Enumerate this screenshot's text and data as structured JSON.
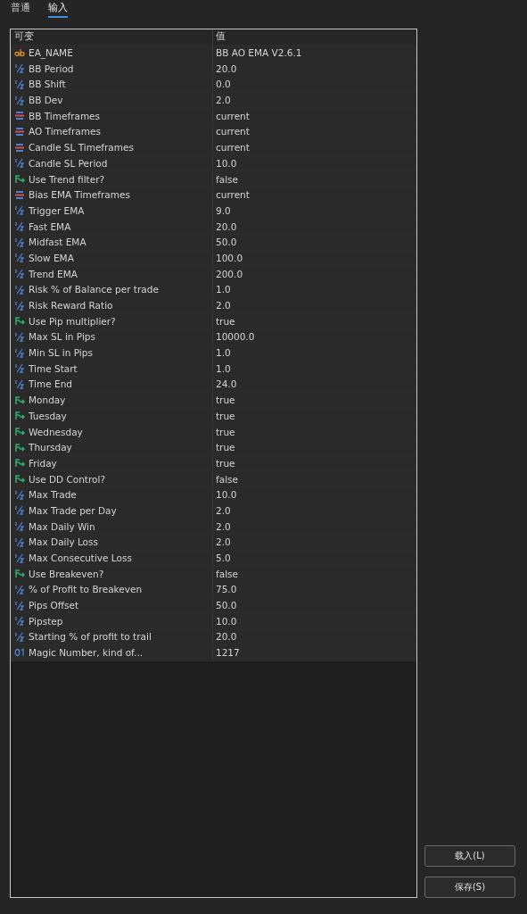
{
  "tabs": [
    {
      "label": "普通",
      "selected": false
    },
    {
      "label": "输入",
      "selected": true
    }
  ],
  "table": {
    "columns": [
      "可变",
      "值"
    ],
    "rows": [
      {
        "kind": "string",
        "name": "EA_NAME",
        "value": "BB AO EMA V2.6.1"
      },
      {
        "kind": "double",
        "name": "BB Period",
        "value": "20.0"
      },
      {
        "kind": "double",
        "name": "BB Shift",
        "value": "0.0"
      },
      {
        "kind": "double",
        "name": "BB Dev",
        "value": "2.0"
      },
      {
        "kind": "enum",
        "name": "BB Timeframes",
        "value": "current"
      },
      {
        "kind": "enum",
        "name": "AO Timeframes",
        "value": "current"
      },
      {
        "kind": "enum",
        "name": "Candle SL Timeframes",
        "value": "current"
      },
      {
        "kind": "double",
        "name": "Candle SL Period",
        "value": "10.0"
      },
      {
        "kind": "bool",
        "name": "Use Trend filter?",
        "value": "false"
      },
      {
        "kind": "enum",
        "name": "Bias EMA Timeframes",
        "value": "current"
      },
      {
        "kind": "double",
        "name": "Trigger EMA",
        "value": "9.0"
      },
      {
        "kind": "double",
        "name": "Fast EMA",
        "value": "20.0"
      },
      {
        "kind": "double",
        "name": "Midfast EMA",
        "value": "50.0"
      },
      {
        "kind": "double",
        "name": "Slow EMA",
        "value": "100.0"
      },
      {
        "kind": "double",
        "name": "Trend EMA",
        "value": "200.0"
      },
      {
        "kind": "double",
        "name": "Risk % of Balance per trade",
        "value": "1.0"
      },
      {
        "kind": "double",
        "name": "Risk Reward Ratio",
        "value": "2.0"
      },
      {
        "kind": "bool",
        "name": "Use Pip multiplier?",
        "value": "true"
      },
      {
        "kind": "double",
        "name": "Max SL in Pips",
        "value": "10000.0"
      },
      {
        "kind": "double",
        "name": "Min SL in Pips",
        "value": "1.0"
      },
      {
        "kind": "double",
        "name": "Time Start",
        "value": "1.0"
      },
      {
        "kind": "double",
        "name": "Time End",
        "value": "24.0"
      },
      {
        "kind": "bool",
        "name": "Monday",
        "value": "true"
      },
      {
        "kind": "bool",
        "name": "Tuesday",
        "value": "true"
      },
      {
        "kind": "bool",
        "name": "Wednesday",
        "value": "true"
      },
      {
        "kind": "bool",
        "name": "Thursday",
        "value": "true"
      },
      {
        "kind": "bool",
        "name": "Friday",
        "value": "true"
      },
      {
        "kind": "bool",
        "name": "Use DD Control?",
        "value": "false"
      },
      {
        "kind": "double",
        "name": "Max Trade",
        "value": "10.0"
      },
      {
        "kind": "double",
        "name": "Max Trade per Day",
        "value": "2.0"
      },
      {
        "kind": "double",
        "name": "Max Daily Win",
        "value": "2.0"
      },
      {
        "kind": "double",
        "name": "Max Daily Loss",
        "value": "2.0"
      },
      {
        "kind": "double",
        "name": "Max Consecutive Loss",
        "value": "5.0"
      },
      {
        "kind": "bool",
        "name": "Use Breakeven?",
        "value": "false"
      },
      {
        "kind": "double",
        "name": "% of Profit to Breakeven",
        "value": "75.0"
      },
      {
        "kind": "double",
        "name": "Pips Offset",
        "value": "50.0"
      },
      {
        "kind": "double",
        "name": "Pipstep",
        "value": "10.0"
      },
      {
        "kind": "double",
        "name": "Starting % of profit to trail",
        "value": "20.0"
      },
      {
        "kind": "int",
        "name": "Magic Number, kind of...",
        "value": "1217"
      }
    ]
  },
  "buttons": [
    "载入(L)",
    "保存(S)"
  ]
}
